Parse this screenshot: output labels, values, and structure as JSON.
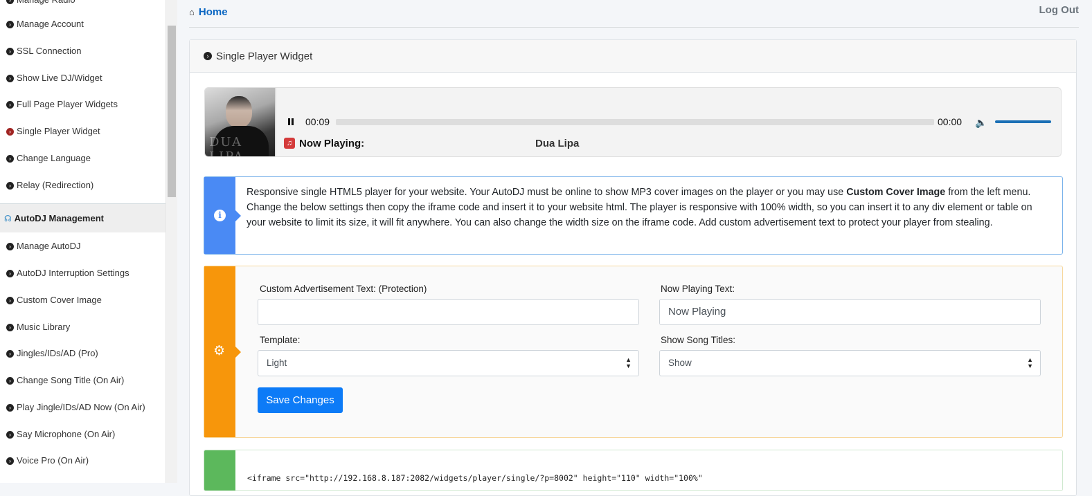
{
  "sidebar": {
    "items_top": [
      {
        "label": "Manage Radio"
      },
      {
        "label": "Manage Account"
      },
      {
        "label": "SSL Connection"
      },
      {
        "label": "Show Live DJ/Widget"
      },
      {
        "label": "Full Page Player Widgets"
      },
      {
        "label": "Single Player Widget"
      },
      {
        "label": "Change Language"
      },
      {
        "label": "Relay (Redirection)"
      }
    ],
    "section_title": "AutoDJ Management",
    "items_bottom": [
      {
        "label": "Manage AutoDJ"
      },
      {
        "label": "AutoDJ Interruption Settings"
      },
      {
        "label": "Custom Cover Image"
      },
      {
        "label": "Music Library"
      },
      {
        "label": "Jingles/IDs/AD (Pro)"
      },
      {
        "label": "Change Song Title (On Air)"
      },
      {
        "label": "Play Jingle/IDs/AD Now (On Air)"
      },
      {
        "label": "Say Microphone (On Air)"
      },
      {
        "label": "Voice Pro (On Air)"
      }
    ]
  },
  "topbar": {
    "home_label": "Home",
    "logout_label": "Log Out"
  },
  "card": {
    "title": "Single Player Widget"
  },
  "player": {
    "current_time": "00:09",
    "total_time": "00:00",
    "progress": 0,
    "volume": 1.0,
    "now_playing_label": "Now Playing:",
    "artist": "Dua Lipa",
    "cover_text": "DUA LIPA"
  },
  "info": {
    "text_before": "Responsive single HTML5 player for your website. Your AutoDJ must be online to show MP3 cover images on the player or you may use ",
    "bold": "Custom Cover Image",
    "text_after": " from the left menu. Change the below settings then copy the iframe code and insert it to your website html. The player is responsive with 100% width, so you can insert it to any div element or table on your website to limit its size, it will fit anywhere. You can also change the width size on the iframe code. Add custom advertisement text to protect your player from stealing."
  },
  "form": {
    "ad_label": "Custom Advertisement Text: (Protection)",
    "ad_value": "",
    "np_label": "Now Playing Text:",
    "np_value": "Now Playing",
    "template_label": "Template:",
    "template_value": "Light",
    "titles_label": "Show Song Titles:",
    "titles_value": "Show",
    "save_label": "Save Changes"
  },
  "code": {
    "snippet": "<iframe src=\"http://192.168.8.187:2082/widgets/player/single/?p=8002\" height=\"110\" width=\"100%\""
  },
  "colors": {
    "info_accent": "#4a8af4",
    "form_accent": "#f7960b",
    "code_accent": "#5cb85c",
    "primary_button": "#0d7bf7",
    "active_nav": "#a02422"
  }
}
